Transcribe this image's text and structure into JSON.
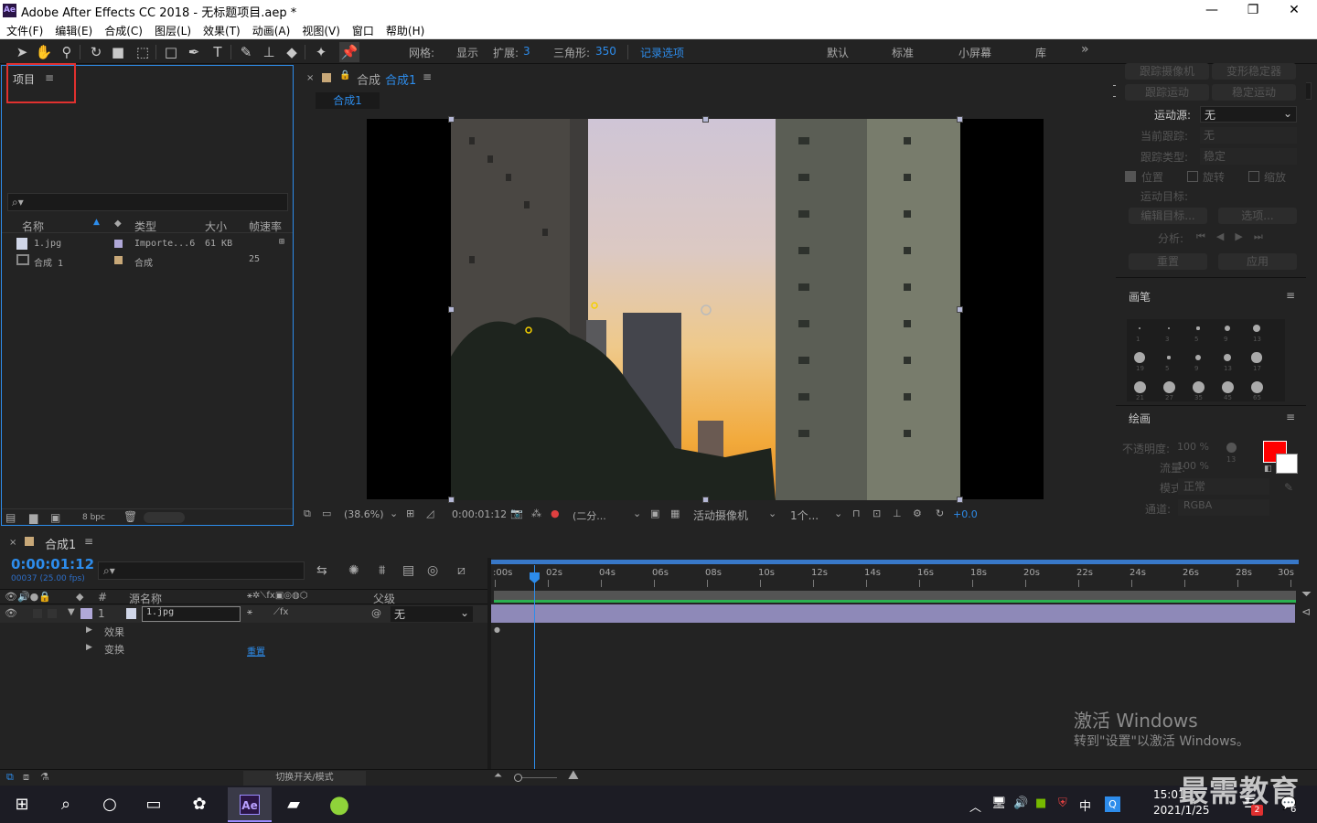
{
  "titlebar": {
    "app_icon": "Ae",
    "title": "Adobe After Effects CC 2018 - 无标题项目.aep *",
    "min": "—",
    "max": "❐",
    "close": "✕"
  },
  "menu": [
    "文件(F)",
    "编辑(E)",
    "合成(C)",
    "图层(L)",
    "效果(T)",
    "动画(A)",
    "视图(V)",
    "窗口",
    "帮助(H)"
  ],
  "toolbar": {
    "grid_label": "网格:",
    "show_label": "显示",
    "expand_label": "扩展:",
    "expand_value": "3",
    "triangle_label": "三角形:",
    "triangle_value": "350",
    "record_options": "记录选项",
    "workspaces": [
      "默认",
      "标准",
      "小屏幕",
      "库"
    ],
    "more": "»"
  },
  "project": {
    "title": "项目",
    "menu_icon": "≡",
    "columns": {
      "name": "名称",
      "type": "类型",
      "size": "大小",
      "fps": "帧速率"
    },
    "items": [
      {
        "name": "1.jpg",
        "type": "Importe...6",
        "size": "61 KB",
        "fps": ""
      },
      {
        "name": "合成 1",
        "type": "合成",
        "size": "",
        "fps": "25"
      }
    ],
    "bpc": "8 bpc"
  },
  "comp": {
    "tab_label": "合成",
    "tab_name": "合成1",
    "breadcrumb": "合成1",
    "zoom": "(38.6%)",
    "timecode": "0:00:01:12",
    "resolution": "(二分...",
    "camera": "活动摄像机",
    "views": "1个...",
    "exposure": "+0.0"
  },
  "tracker": {
    "track_camera": "跟踪摄像机",
    "warp_stabilizer": "变形稳定器",
    "track_motion": "跟踪运动",
    "stabilize_motion": "稳定运动",
    "motion_source_label": "运动源:",
    "motion_source_value": "无",
    "current_track_label": "当前跟踪:",
    "current_track_value": "无",
    "track_type_label": "跟踪类型:",
    "track_type_value": "稳定",
    "position": "位置",
    "rotation": "旋转",
    "scale": "缩放",
    "motion_target": "运动目标:",
    "edit_target": "编辑目标...",
    "options": "选项...",
    "analyze": "分析:",
    "reset": "重置",
    "apply": "应用"
  },
  "brushes": {
    "title": "画笔",
    "sizes": [
      "1",
      "3",
      "5",
      "9",
      "13",
      "19",
      "5",
      "9",
      "13",
      "17",
      "21",
      "27",
      "35",
      "45",
      "65"
    ]
  },
  "paint": {
    "title": "绘画",
    "opacity_label": "不透明度:",
    "opacity_value": "100 %",
    "flow_label": "流量:",
    "flow_value": "100 %",
    "mode_label": "模式:",
    "mode_value": "正常",
    "channel_label": "通道:",
    "channel_value": "RGBA",
    "brush_size": "13",
    "fg_color": "#ff0000",
    "bg_color": "#ffffff"
  },
  "timeline": {
    "tab_name": "合成1",
    "timecode": "0:00:01:12",
    "frame_info": "00037 (25.00 fps)",
    "cols": {
      "num": "#",
      "source": "源名称",
      "parent": "父级"
    },
    "layer": {
      "index": "1",
      "name": "1.jpg",
      "parent": "无"
    },
    "effects": "效果",
    "transform": "变换",
    "reset": "重置",
    "ruler": [
      ":00s",
      "02s",
      "04s",
      "06s",
      "08s",
      "10s",
      "12s",
      "14s",
      "16s",
      "18s",
      "20s",
      "22s",
      "24s",
      "26s",
      "28s",
      "30s"
    ],
    "playhead_seconds": 1.48,
    "duration_seconds": 30,
    "toggle_modes": "切换开关/模式"
  },
  "watermark": {
    "line1": "激活 Windows",
    "line2": "转到\"设置\"以激活 Windows。",
    "brand": "最需教育"
  },
  "taskbar": {
    "ime": "中",
    "time": "15:01",
    "date": "2021/1/25",
    "notif_count": "6",
    "badge": "2",
    "ae_label": "Ae"
  }
}
